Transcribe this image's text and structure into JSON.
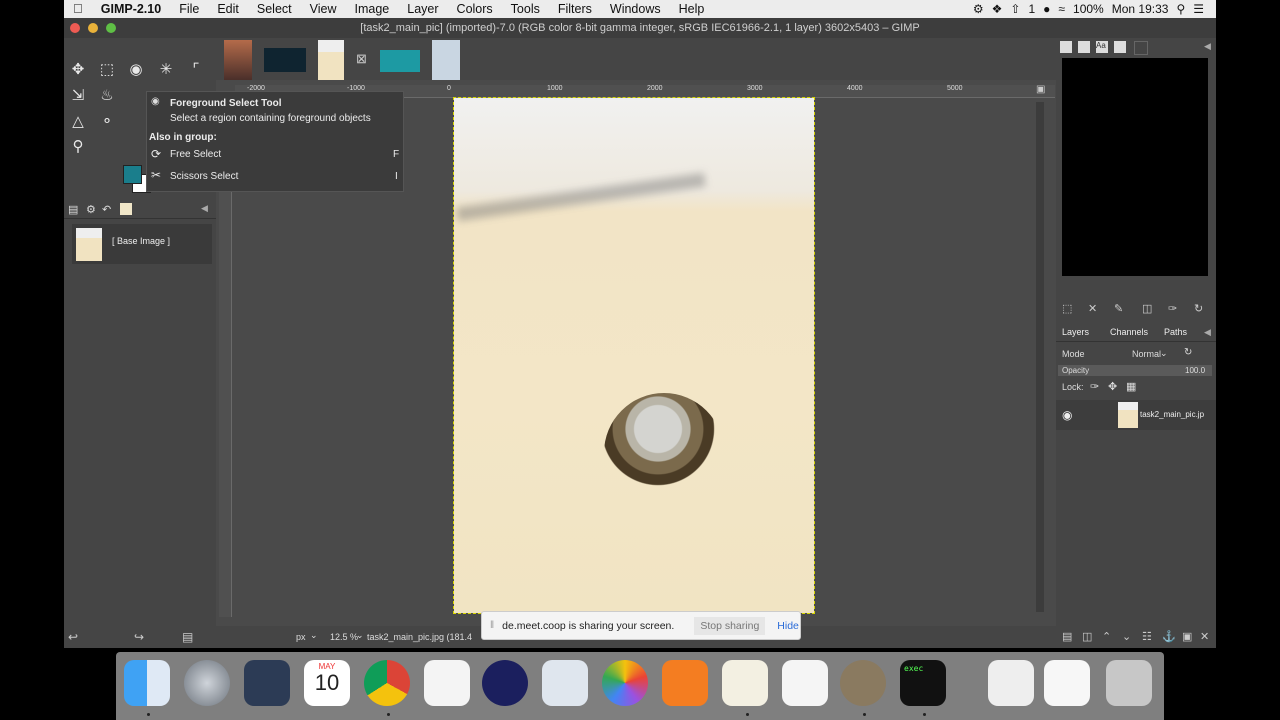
{
  "menubar": {
    "app_name": "GIMP-2.10",
    "items": [
      "File",
      "Edit",
      "Select",
      "View",
      "Image",
      "Layer",
      "Colors",
      "Tools",
      "Filters",
      "Windows",
      "Help"
    ],
    "battery": "100%",
    "clock": "Mon 19:33",
    "input_indicator": "1"
  },
  "window": {
    "title": "[task2_main_pic] (imported)-7.0 (RGB color 8-bit gamma integer, sRGB IEC61966-2.1, 1 layer) 3602x5403 – GIMP"
  },
  "tooltip": {
    "title": "Foreground Select Tool",
    "description": "Select a region containing foreground objects",
    "group_header": "Also in group:",
    "items": [
      {
        "label": "Free Select",
        "shortcut": "F"
      },
      {
        "label": "Scissors Select",
        "shortcut": "I"
      }
    ]
  },
  "images_panel": {
    "item_label": "[ Base Image ]"
  },
  "ruler": {
    "h_labels": [
      "-2000",
      "-1000",
      "0",
      "1000",
      "2000",
      "3000",
      "4000",
      "5000"
    ]
  },
  "layers_dock": {
    "tabs": [
      "Layers",
      "Channels",
      "Paths"
    ],
    "mode_label": "Mode",
    "mode_value": "Normal",
    "opacity_label": "Opacity",
    "opacity_value": "100.0",
    "lock_label": "Lock:",
    "layer_name": "task2_main_pic.jp"
  },
  "statusbar": {
    "unit": "px",
    "zoom": "12.5 %",
    "filename": "task2_main_pic.jpg (181.4"
  },
  "sharing": {
    "message": "de.meet.coop is sharing your screen.",
    "stop_label": "Stop sharing",
    "hide_label": "Hide"
  },
  "calendar": {
    "month": "MAY",
    "day": "10"
  },
  "terminal_label": "exec",
  "colors": {
    "fg_color": "#1a7e8c",
    "bg_color": "#ffffff"
  }
}
